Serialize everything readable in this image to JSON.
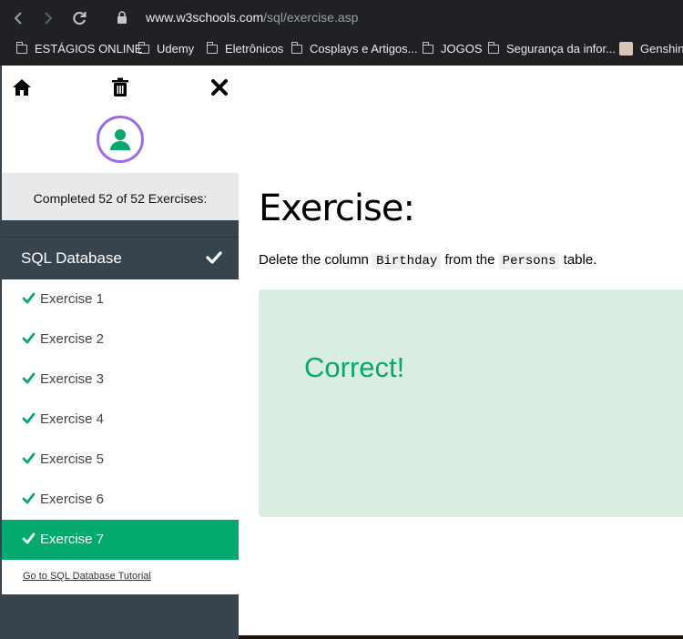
{
  "browser": {
    "url_host": "www.w3schools.com",
    "url_path": "/sql/exercise.asp",
    "bookmarks": [
      {
        "label": "ESTÁGIOS ONLINE",
        "icon": "folder-icon"
      },
      {
        "label": "Udemy",
        "icon": "folder-icon"
      },
      {
        "label": "Eletrônicos",
        "icon": "folder-icon"
      },
      {
        "label": "Cosplays e Artigos...",
        "icon": "folder-icon"
      },
      {
        "label": "JOGOS",
        "icon": "folder-icon"
      },
      {
        "label": "Segurança da infor...",
        "icon": "folder-icon"
      },
      {
        "label": "Genshin",
        "icon": "avatar-icon"
      }
    ]
  },
  "sidebar": {
    "completed_text": "Completed 52 of 52 Exercises:",
    "section_title": "SQL Database",
    "exercises": [
      {
        "label": "Exercise 1",
        "done": true
      },
      {
        "label": "Exercise 2",
        "done": true
      },
      {
        "label": "Exercise 3",
        "done": true
      },
      {
        "label": "Exercise 4",
        "done": true
      },
      {
        "label": "Exercise 5",
        "done": true
      },
      {
        "label": "Exercise 6",
        "done": true
      },
      {
        "label": "Exercise 7",
        "done": true,
        "active": true
      }
    ],
    "tutorial_link": "Go to SQL Database Tutorial",
    "colors": {
      "panel": "#38444d",
      "active": "#04aa6d",
      "ring": "#9a6bf0"
    }
  },
  "main": {
    "heading": "Exercise:",
    "desc_before": "Delete the column",
    "desc_code1": "Birthday",
    "desc_middle": "from the",
    "desc_code2": "Persons",
    "desc_after": "table.",
    "result": "Correct!",
    "colors": {
      "result_bg": "#d9eee1",
      "result_text": "#04aa6d"
    }
  }
}
